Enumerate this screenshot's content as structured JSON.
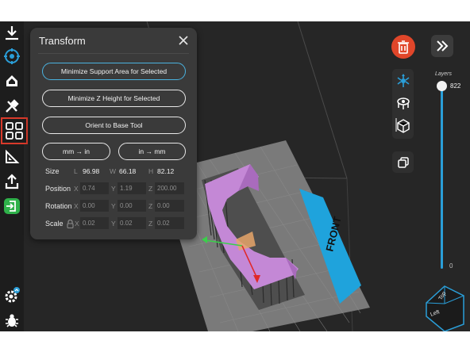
{
  "panel": {
    "title": "Transform",
    "buttons": {
      "min_support": "Minimize Support Area for Selected",
      "min_z": "Minimize Z Height for Selected",
      "orient": "Orient to Base Tool",
      "mm_to_in": "mm → in",
      "in_to_mm": "in → mm"
    },
    "size": {
      "label": "Size",
      "l_axis": "L",
      "l": "96.98",
      "w_axis": "W",
      "w": "66.18",
      "h_axis": "H",
      "h": "82.12"
    },
    "position": {
      "label": "Position",
      "x_axis": "X",
      "x": "0.74",
      "y_axis": "Y",
      "y": "1.19",
      "z_axis": "Z",
      "z": "200.00"
    },
    "rotation": {
      "label": "Rotation",
      "x_axis": "X",
      "x": "0.00",
      "y_axis": "Y",
      "y": "0.00",
      "z_axis": "Z",
      "z": "0.00"
    },
    "scale": {
      "label": "Scale",
      "x_axis": "X",
      "x": "0.02",
      "y_axis": "Y",
      "y": "0.02",
      "z_axis": "Z",
      "z": "0.02"
    }
  },
  "layers": {
    "label": "Layers",
    "top": "822",
    "bottom": "0"
  },
  "viewport": {
    "front_label": "FRONT"
  },
  "view_cube": {
    "top": "Top",
    "left": "Left"
  },
  "colors": {
    "accent": "#2a9ed8",
    "delete": "#e0462a",
    "model": "#c488d6",
    "plate": "#7a7a7a",
    "front_tab": "#1fa3dc",
    "active_outline": "#d93a2b"
  },
  "icons": {
    "toolbar": [
      "download-icon",
      "rotate-view-icon",
      "erase-icon",
      "tools-icon",
      "grid-icon",
      "ruler-icon",
      "export-icon",
      "exit-icon",
      "settings-icon",
      "bug-icon"
    ],
    "right": [
      "trash-icon",
      "forward-icon",
      "model-view-icon",
      "support-view-icon",
      "cube-view-icon",
      "duplicate-icon"
    ]
  }
}
